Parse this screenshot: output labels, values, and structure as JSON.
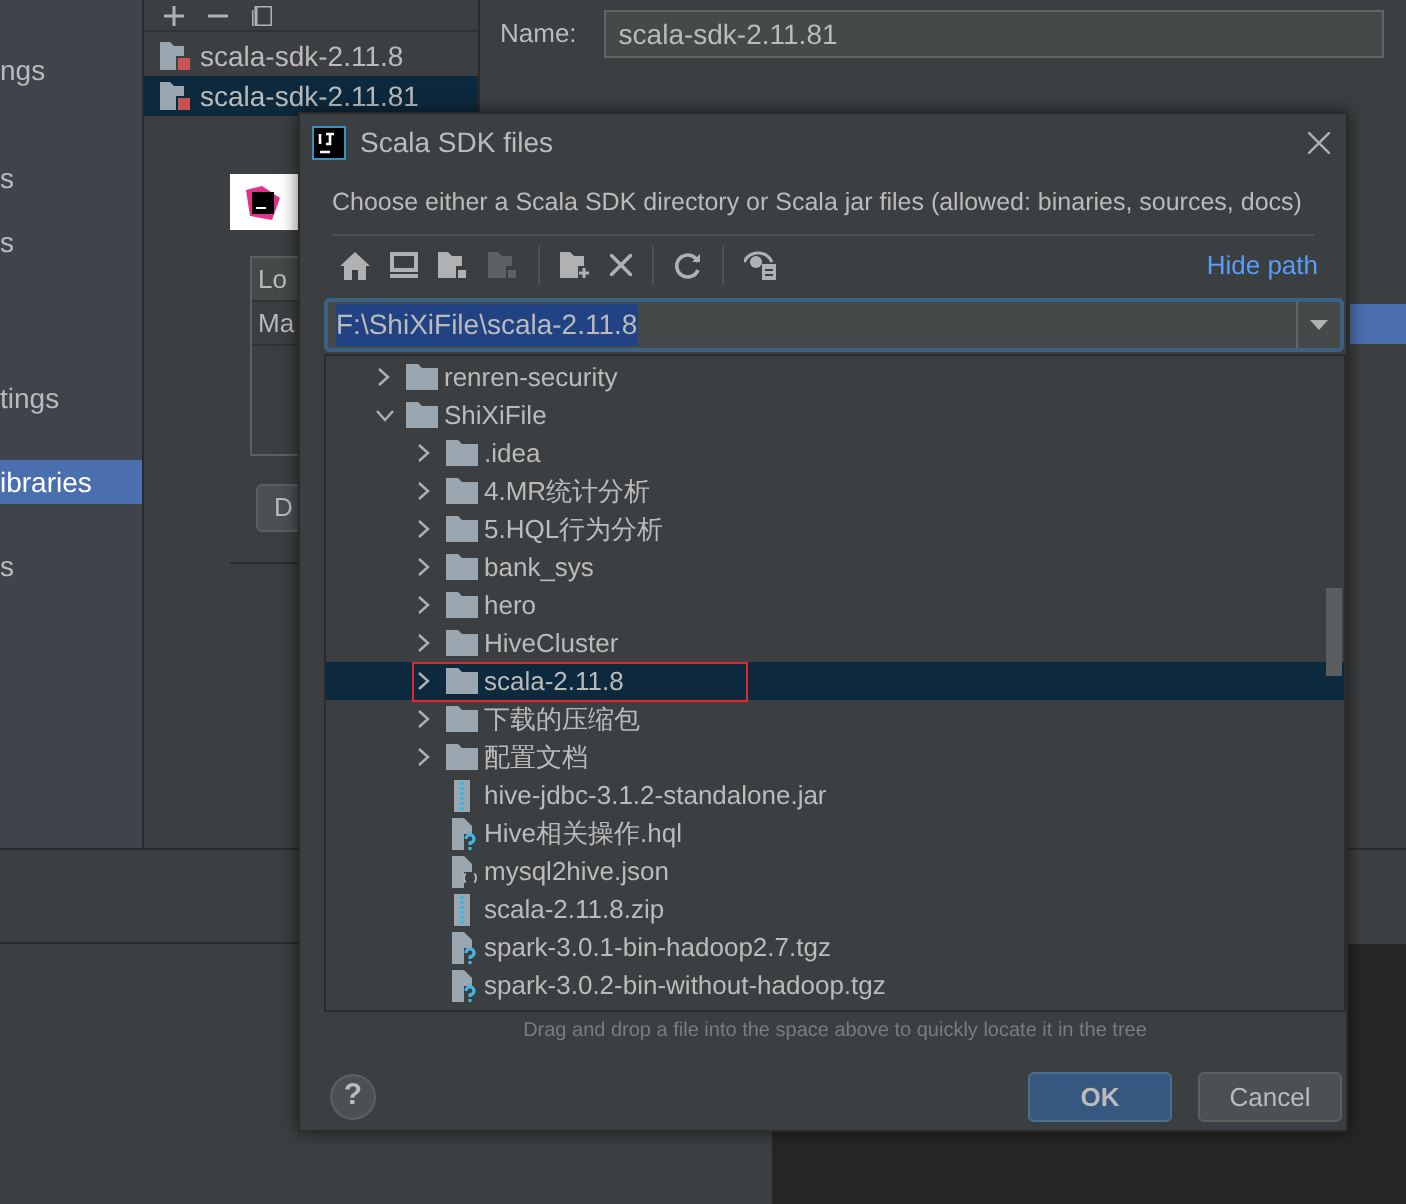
{
  "settings_window": {
    "sidebar_items": [
      {
        "label": "ngs",
        "selected": false
      },
      {
        "label": "s",
        "selected": false
      },
      {
        "label": "s",
        "selected": false
      },
      {
        "label": "tings",
        "selected": false
      },
      {
        "label": "ibraries",
        "selected": true
      },
      {
        "label": "s",
        "selected": false
      }
    ],
    "sdks": [
      {
        "name": "scala-sdk-2.11.8",
        "selected": false
      },
      {
        "name": "scala-sdk-2.11.81",
        "selected": true
      }
    ],
    "name_label": "Name:",
    "name_value": "scala-sdk-2.11.81"
  },
  "background_dialog": {
    "table_header": "Lo",
    "table_row": "Ma",
    "button": "D"
  },
  "dialog": {
    "title": "Scala SDK files",
    "description": "Choose either a Scala SDK directory or Scala jar files (allowed: binaries, sources, docs)",
    "hide_path_link": "Hide path",
    "path": "F:\\ShiXiFile\\scala-2.11.8",
    "tree": [
      {
        "name": "renren-security",
        "kind": "folder",
        "expanded": false,
        "selected": false,
        "highlighted": false
      },
      {
        "name": "ShiXiFile",
        "kind": "folder",
        "expanded": true,
        "selected": false,
        "highlighted": false,
        "children": [
          {
            "name": ".idea",
            "kind": "folder",
            "expanded": false,
            "selected": false,
            "highlighted": false
          },
          {
            "name": "4.MR统计分析",
            "kind": "folder",
            "expanded": false,
            "selected": false,
            "highlighted": false
          },
          {
            "name": "5.HQL行为分析",
            "kind": "folder",
            "expanded": false,
            "selected": false,
            "highlighted": false
          },
          {
            "name": "bank_sys",
            "kind": "folder",
            "expanded": false,
            "selected": false,
            "highlighted": false
          },
          {
            "name": "hero",
            "kind": "folder",
            "expanded": false,
            "selected": false,
            "highlighted": false
          },
          {
            "name": "HiveCluster",
            "kind": "folder",
            "expanded": false,
            "selected": false,
            "highlighted": false
          },
          {
            "name": "scala-2.11.8",
            "kind": "folder",
            "expanded": false,
            "selected": true,
            "highlighted": true
          },
          {
            "name": "下载的压缩包",
            "kind": "folder",
            "expanded": false,
            "selected": false,
            "highlighted": false
          },
          {
            "name": "配置文档",
            "kind": "folder",
            "expanded": false,
            "selected": false,
            "highlighted": false
          },
          {
            "name": "hive-jdbc-3.1.2-standalone.jar",
            "kind": "archive",
            "selected": false,
            "highlighted": false
          },
          {
            "name": "Hive相关操作.hql",
            "kind": "unknown",
            "selected": false,
            "highlighted": false
          },
          {
            "name": "mysql2hive.json",
            "kind": "json",
            "selected": false,
            "highlighted": false
          },
          {
            "name": "scala-2.11.8.zip",
            "kind": "archive",
            "selected": false,
            "highlighted": false
          },
          {
            "name": "spark-3.0.1-bin-hadoop2.7.tgz",
            "kind": "unknown",
            "selected": false,
            "highlighted": false
          },
          {
            "name": "spark-3.0.2-bin-without-hadoop.tgz",
            "kind": "unknown",
            "selected": false,
            "highlighted": false
          }
        ]
      }
    ],
    "hint": "Drag and drop a file into the space above to quickly locate it in the tree",
    "help_button": "?",
    "buttons": [
      {
        "label": "OK",
        "default": true
      },
      {
        "label": "Cancel",
        "default": false
      }
    ]
  }
}
